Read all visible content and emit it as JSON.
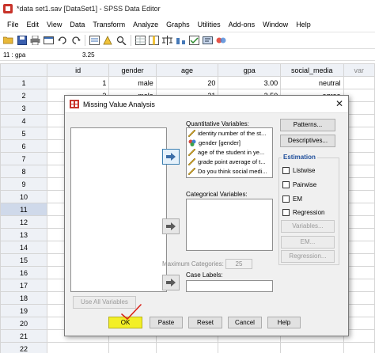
{
  "window": {
    "title": "*data set1.sav [DataSet1] - SPSS Data Editor"
  },
  "menubar": [
    "File",
    "Edit",
    "View",
    "Data",
    "Transform",
    "Analyze",
    "Graphs",
    "Utilities",
    "Add-ons",
    "Window",
    "Help"
  ],
  "toolbar_icons": [
    "open-folder-icon",
    "save-icon",
    "print-icon",
    "dialog-recall-icon",
    "undo-icon",
    "redo-icon",
    "goto-case-icon",
    "variables-icon",
    "find-icon",
    "insert-cases-icon",
    "insert-variable-icon",
    "split-file-icon",
    "weight-cases-icon",
    "select-cases-icon",
    "value-labels-icon",
    "use-sets-icon"
  ],
  "cellbar": {
    "cell_ref": "11 : gpa",
    "cell_value": "3.25"
  },
  "grid": {
    "columns": [
      "id",
      "gender",
      "age",
      "gpa",
      "social_media",
      "var"
    ],
    "rows": [
      {
        "n": "1",
        "cells": [
          "1",
          "male",
          "20",
          "3.00",
          "neutral",
          ""
        ]
      },
      {
        "n": "2",
        "cells": [
          "2",
          "male",
          "21",
          "3.50",
          "agree",
          ""
        ]
      },
      {
        "n": "3",
        "cells": [
          "",
          "",
          "",
          "",
          "",
          ""
        ]
      },
      {
        "n": "4",
        "cells": [
          "",
          "",
          "",
          "",
          "",
          ""
        ]
      },
      {
        "n": "5",
        "cells": [
          "",
          "",
          "",
          "",
          "",
          ""
        ]
      },
      {
        "n": "6",
        "cells": [
          "",
          "",
          "",
          "",
          "",
          ""
        ]
      },
      {
        "n": "7",
        "cells": [
          "",
          "",
          "",
          "",
          "",
          ""
        ]
      },
      {
        "n": "8",
        "cells": [
          "",
          "",
          "",
          "",
          "",
          ""
        ]
      },
      {
        "n": "9",
        "cells": [
          "",
          "",
          "",
          "",
          "",
          ""
        ]
      },
      {
        "n": "10",
        "cells": [
          "",
          "",
          "",
          "",
          "",
          ""
        ]
      },
      {
        "n": "11",
        "cells": [
          "",
          "",
          "",
          "",
          "",
          ""
        ]
      },
      {
        "n": "12",
        "cells": [
          "",
          "",
          "",
          "",
          "",
          ""
        ]
      },
      {
        "n": "13",
        "cells": [
          "",
          "",
          "",
          "",
          "",
          ""
        ]
      },
      {
        "n": "14",
        "cells": [
          "",
          "",
          "",
          "",
          "",
          ""
        ]
      },
      {
        "n": "15",
        "cells": [
          "",
          "",
          "",
          "",
          "",
          ""
        ]
      },
      {
        "n": "16",
        "cells": [
          "",
          "",
          "",
          "",
          "",
          ""
        ]
      },
      {
        "n": "17",
        "cells": [
          "",
          "",
          "",
          "",
          "",
          ""
        ]
      },
      {
        "n": "18",
        "cells": [
          "",
          "",
          "",
          "",
          "",
          ""
        ]
      },
      {
        "n": "19",
        "cells": [
          "",
          "",
          "",
          "",
          "",
          ""
        ]
      },
      {
        "n": "20",
        "cells": [
          "",
          "",
          "",
          "",
          "",
          ""
        ]
      },
      {
        "n": "21",
        "cells": [
          "",
          "",
          "",
          "",
          "",
          ""
        ]
      },
      {
        "n": "22",
        "cells": [
          "",
          "",
          "",
          "",
          "",
          ""
        ]
      }
    ]
  },
  "dialog": {
    "title": "Missing Value Analysis",
    "quantitative_label": "Quantitative Variables:",
    "quantitative_vars": [
      {
        "text": "identity number of the st...",
        "icon": "ruler-icon"
      },
      {
        "text": "gender  [gender]",
        "icon": "nominal-icon"
      },
      {
        "text": "age of the student in ye...",
        "icon": "ruler-icon"
      },
      {
        "text": "grade point average of t...",
        "icon": "ruler-icon"
      },
      {
        "text": "Do you think social medi...",
        "icon": "ruler-icon"
      }
    ],
    "categorical_label": "Categorical Variables:",
    "max_categories_label": "Maximum Categories:",
    "max_categories_value": "25",
    "case_labels_label": "Case Labels:",
    "use_all_label": "Use All Variables",
    "patterns_label": "Patterns...",
    "descriptives_label": "Descriptives...",
    "estimation_title": "Estimation",
    "checkboxes": [
      "Listwise",
      "Pairwise",
      "EM",
      "Regression"
    ],
    "variables_btn": "Variables...",
    "em_btn": "EM...",
    "regression_btn": "Regression...",
    "ok_label": "OK",
    "paste_label": "Paste",
    "reset_label": "Reset",
    "cancel_label": "Cancel",
    "help_label": "Help",
    "colors": {
      "ok_highlight": "#f3ef27",
      "estimation_title": "#1f4e9a",
      "annotation": "#d9261c"
    }
  }
}
